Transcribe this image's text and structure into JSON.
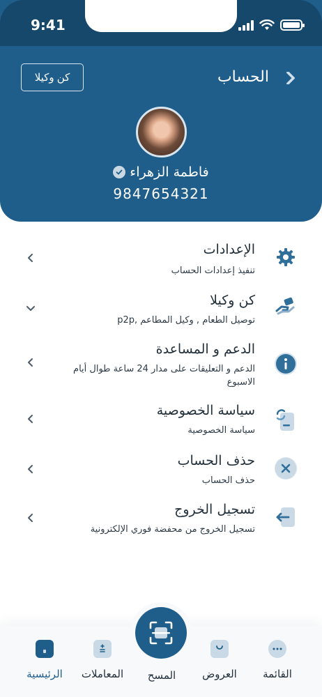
{
  "status_bar": {
    "time": "9:41"
  },
  "header": {
    "title": "الحساب",
    "agent_button": "كن وكيلا",
    "user_name": "فاطمة الزهراء",
    "phone": "9847654321"
  },
  "menu": [
    {
      "title": "الإعدادات",
      "subtitle": "تنفيذ إعدادات الحساب",
      "icon": "gear-icon"
    },
    {
      "title": "كن وكيلا",
      "subtitle": "توصيل الطعام , وكيل المطاعم ,p2p",
      "icon": "hand-money-icon"
    },
    {
      "title": "الدعم و المساعدة",
      "subtitle": "الدعم و التعليقات على مدار 24 ساعة طوال أيام الاسبوع",
      "icon": "info-icon"
    },
    {
      "title": "سياسة الخصوصية",
      "subtitle": "سياسة الخصوصية",
      "icon": "privacy-doc-icon"
    },
    {
      "title": "حذف الحساب",
      "subtitle": "حذف الحساب",
      "icon": "delete-icon"
    },
    {
      "title": "تسجيل الخروج",
      "subtitle": "تسجيل الخروج من محفضة فوري الإلكترونية",
      "icon": "logout-icon"
    }
  ],
  "bottom_nav": {
    "home": "الرئيسية",
    "transactions": "المعاملات",
    "scan": "المسح",
    "offers": "العروض",
    "menu": "القائمة"
  },
  "colors": {
    "primary": "#1f5e8a",
    "header_top": "#16486c",
    "icon_bg": "#d4e1eb",
    "icon_fg": "#2f6f9a"
  }
}
